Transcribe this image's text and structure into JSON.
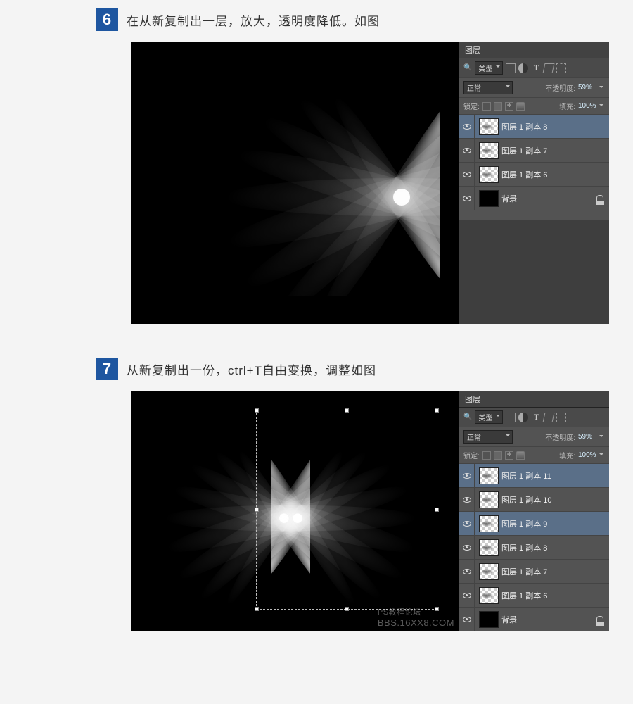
{
  "steps": [
    {
      "num": "6",
      "text": "在从新复制出一层，放大，透明度降低。如图"
    },
    {
      "num": "7",
      "text": "从新复制出一份，ctrl+T自由变换，调整如图"
    }
  ],
  "panel": {
    "tab": "图层",
    "typeFilter": "类型",
    "blendMode": "正常",
    "opacityLabel": "不透明度:",
    "opacityValue": "59%",
    "lockLabel": "锁定:",
    "fillLabel": "填充:",
    "fillValue": "100%"
  },
  "layersA": [
    {
      "name": "图层 1 副本 8",
      "selected": true,
      "bg": false
    },
    {
      "name": "图层 1 副本 7",
      "selected": false,
      "bg": false
    },
    {
      "name": "图层 1 副本 6",
      "selected": false,
      "bg": false
    },
    {
      "name": "背景",
      "selected": false,
      "bg": true
    }
  ],
  "layersB": [
    {
      "name": "图层 1 副本 11",
      "selected": true,
      "bg": false
    },
    {
      "name": "图层 1 副本 10",
      "selected": false,
      "bg": false
    },
    {
      "name": "图层 1 副本 9",
      "selected": true,
      "bg": false
    },
    {
      "name": "图层 1 副本 8",
      "selected": false,
      "bg": false
    },
    {
      "name": "图层 1 副本 7",
      "selected": false,
      "bg": false
    },
    {
      "name": "图层 1 副本 6",
      "selected": false,
      "bg": false
    },
    {
      "name": "背景",
      "selected": false,
      "bg": true
    }
  ],
  "watermark": {
    "line1": "PS教程论坛",
    "line2": "BBS.16XX8.COM"
  }
}
